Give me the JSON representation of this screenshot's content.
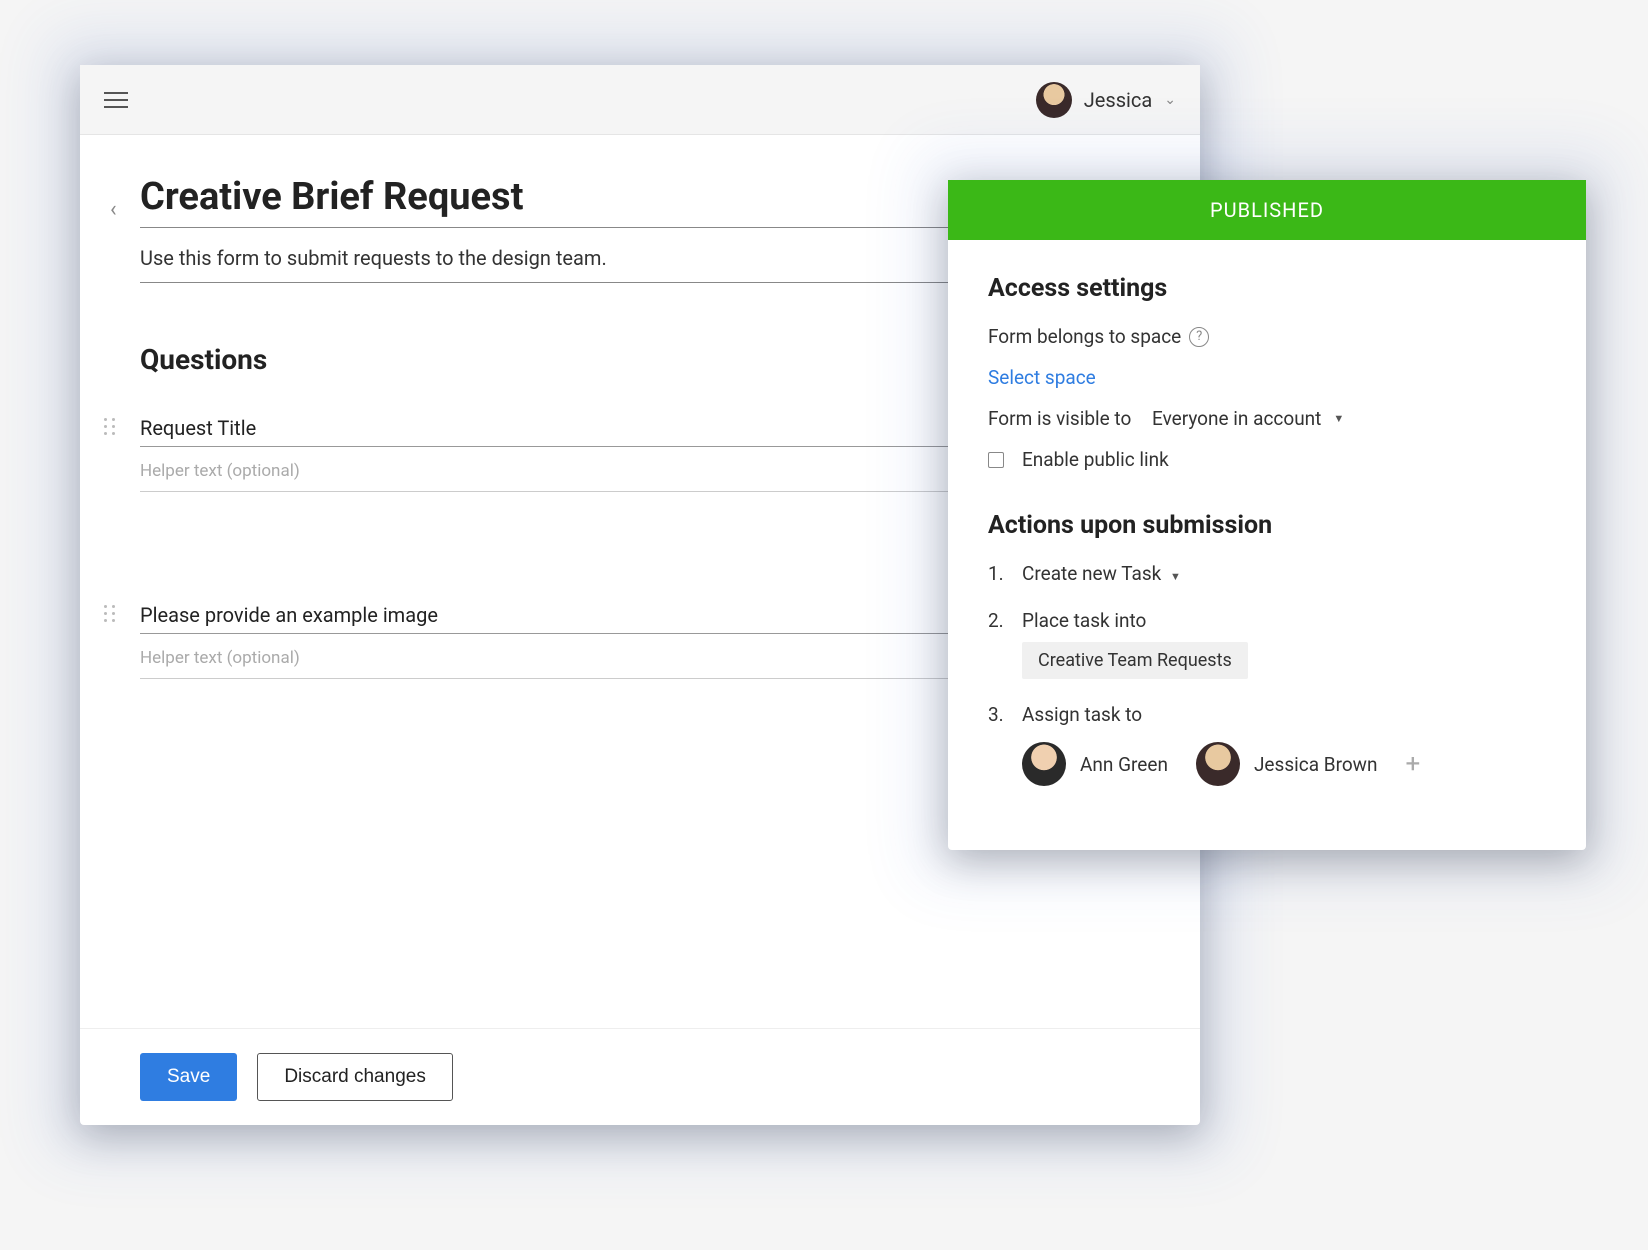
{
  "topbar": {
    "user_name": "Jessica"
  },
  "form": {
    "title": "Creative Brief Request",
    "description": "Use this form to submit requests to the design team.",
    "questions_heading": "Questions",
    "questions": [
      {
        "label": "Request Title",
        "helper_placeholder": "Helper text (optional)",
        "type": "Short answer"
      },
      {
        "label": "Please provide an example image",
        "helper_placeholder": "Helper text (optional)",
        "type": "Short answer"
      }
    ]
  },
  "footer": {
    "save": "Save",
    "discard": "Discard changes"
  },
  "panel": {
    "status": "PUBLISHED",
    "access_heading": "Access settings",
    "belongs_label": "Form belongs to space",
    "select_space": "Select space",
    "visibility_prefix": "Form is visible to",
    "visibility_value": "Everyone in account",
    "public_link_label": "Enable public link",
    "actions_heading": "Actions upon submission",
    "actions": {
      "a1_num": "1.",
      "a1_label": "Create new Task",
      "a2_num": "2.",
      "a2_label": "Place task into",
      "a2_chip": "Creative Team Requests",
      "a3_num": "3.",
      "a3_label": "Assign task to",
      "assignees": [
        {
          "name": "Ann Green"
        },
        {
          "name": "Jessica Brown"
        }
      ]
    }
  }
}
